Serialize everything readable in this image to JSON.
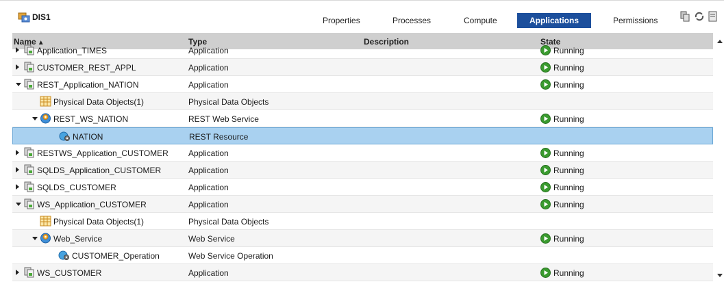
{
  "header": {
    "title": "DIS1",
    "tabs": [
      {
        "label": "Properties",
        "active": false
      },
      {
        "label": "Processes",
        "active": false
      },
      {
        "label": "Compute",
        "active": false
      },
      {
        "label": "Applications",
        "active": true
      },
      {
        "label": "Permissions",
        "active": false
      }
    ],
    "tool_icons": [
      "deploy-icon",
      "refresh-icon",
      "properties-icon"
    ]
  },
  "grid": {
    "columns": {
      "name": "Name",
      "type": "Type",
      "description": "Description",
      "state": "State"
    },
    "sort_indicator": "ascending",
    "rows": [
      {
        "name": "Application_TIMES",
        "type": "Application",
        "state": "Running",
        "expander": "right",
        "icon": "application-icon",
        "level": 0,
        "partial": true
      },
      {
        "name": "CUSTOMER_REST_APPL",
        "type": "Application",
        "state": "Running",
        "expander": "right",
        "icon": "application-icon",
        "level": 0
      },
      {
        "name": "REST_Application_NATION",
        "type": "Application",
        "state": "Running",
        "expander": "down",
        "icon": "application-icon",
        "level": 0
      },
      {
        "name": "Physical Data Objects(1)",
        "type": "Physical Data Objects",
        "state": "",
        "expander": "none",
        "icon": "table-icon",
        "level": 1
      },
      {
        "name": "REST_WS_NATION",
        "type": "REST Web Service",
        "state": "Running",
        "expander": "down",
        "icon": "web-service-icon",
        "level": 1
      },
      {
        "name": "NATION",
        "type": "REST Resource",
        "state": "",
        "expander": "none",
        "icon": "operation-icon",
        "level": 2,
        "selected": true
      },
      {
        "name": "RESTWS_Application_CUSTOMER",
        "type": "Application",
        "state": "Running",
        "expander": "right",
        "icon": "application-icon",
        "level": 0
      },
      {
        "name": "SQLDS_Application_CUSTOMER",
        "type": "Application",
        "state": "Running",
        "expander": "right",
        "icon": "application-icon",
        "level": 0
      },
      {
        "name": "SQLDS_CUSTOMER",
        "type": "Application",
        "state": "Running",
        "expander": "right",
        "icon": "application-icon",
        "level": 0
      },
      {
        "name": "WS_Application_CUSTOMER",
        "type": "Application",
        "state": "Running",
        "expander": "down",
        "icon": "application-icon",
        "level": 0
      },
      {
        "name": "Physical Data Objects(1)",
        "type": "Physical Data Objects",
        "state": "",
        "expander": "none",
        "icon": "table-icon",
        "level": 1
      },
      {
        "name": "Web_Service",
        "type": "Web Service",
        "state": "Running",
        "expander": "down",
        "icon": "web-service-icon",
        "level": 1
      },
      {
        "name": "CUSTOMER_Operation",
        "type": "Web Service Operation",
        "state": "",
        "expander": "none",
        "icon": "operation-icon",
        "level": 2
      },
      {
        "name": "WS_CUSTOMER",
        "type": "Application",
        "state": "Running",
        "expander": "right",
        "icon": "application-icon",
        "level": 0
      }
    ]
  },
  "colors": {
    "active_tab": "#1c4f9c",
    "header_bg": "#cfcfcf",
    "selected_row": "#a9d1f0",
    "running_green": "#3a9b2f"
  }
}
